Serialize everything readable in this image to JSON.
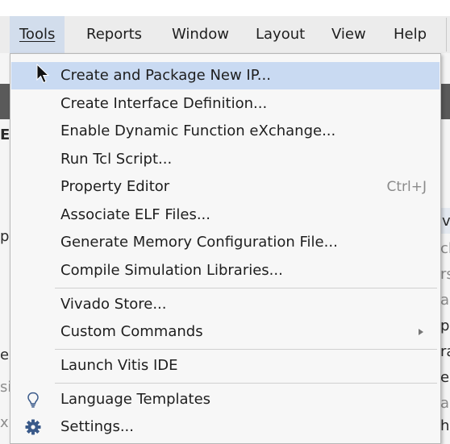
{
  "menubar": {
    "items": [
      {
        "label": "Tools",
        "active": true
      },
      {
        "label": "Reports",
        "active": false
      },
      {
        "label": "Window",
        "active": false
      },
      {
        "label": "Layout",
        "active": false
      },
      {
        "label": "View",
        "active": false
      },
      {
        "label": "Help",
        "active": false
      }
    ]
  },
  "background": {
    "left_fragments": [
      "El",
      "p",
      "e",
      "si",
      "x"
    ],
    "right_fragments": [
      "v",
      "cl",
      "rs",
      "ar",
      "pa",
      "ra",
      "er",
      "ar",
      "he",
      "nc"
    ]
  },
  "tools_menu": {
    "items": [
      {
        "label": "Create and Package New IP...",
        "highlighted": true
      },
      {
        "label": "Create Interface Definition..."
      },
      {
        "label": "Enable Dynamic Function eXchange..."
      },
      {
        "label": "Run Tcl Script..."
      },
      {
        "label": "Property Editor",
        "shortcut": "Ctrl+J"
      },
      {
        "label": "Associate ELF Files..."
      },
      {
        "label": "Generate Memory Configuration File..."
      },
      {
        "label": "Compile Simulation Libraries..."
      },
      {
        "label": "Vivado Store..."
      },
      {
        "label": "Custom Commands",
        "submenu": true
      },
      {
        "label": "Launch Vitis IDE"
      },
      {
        "label": "Language Templates",
        "icon": "lightbulb-icon"
      },
      {
        "label": "Settings...",
        "icon": "gear-icon"
      }
    ]
  },
  "colors": {
    "menubar_active": "#d2ddec",
    "menu_highlight": "#c9daf2",
    "settings_icon": "#3a5a8a"
  }
}
